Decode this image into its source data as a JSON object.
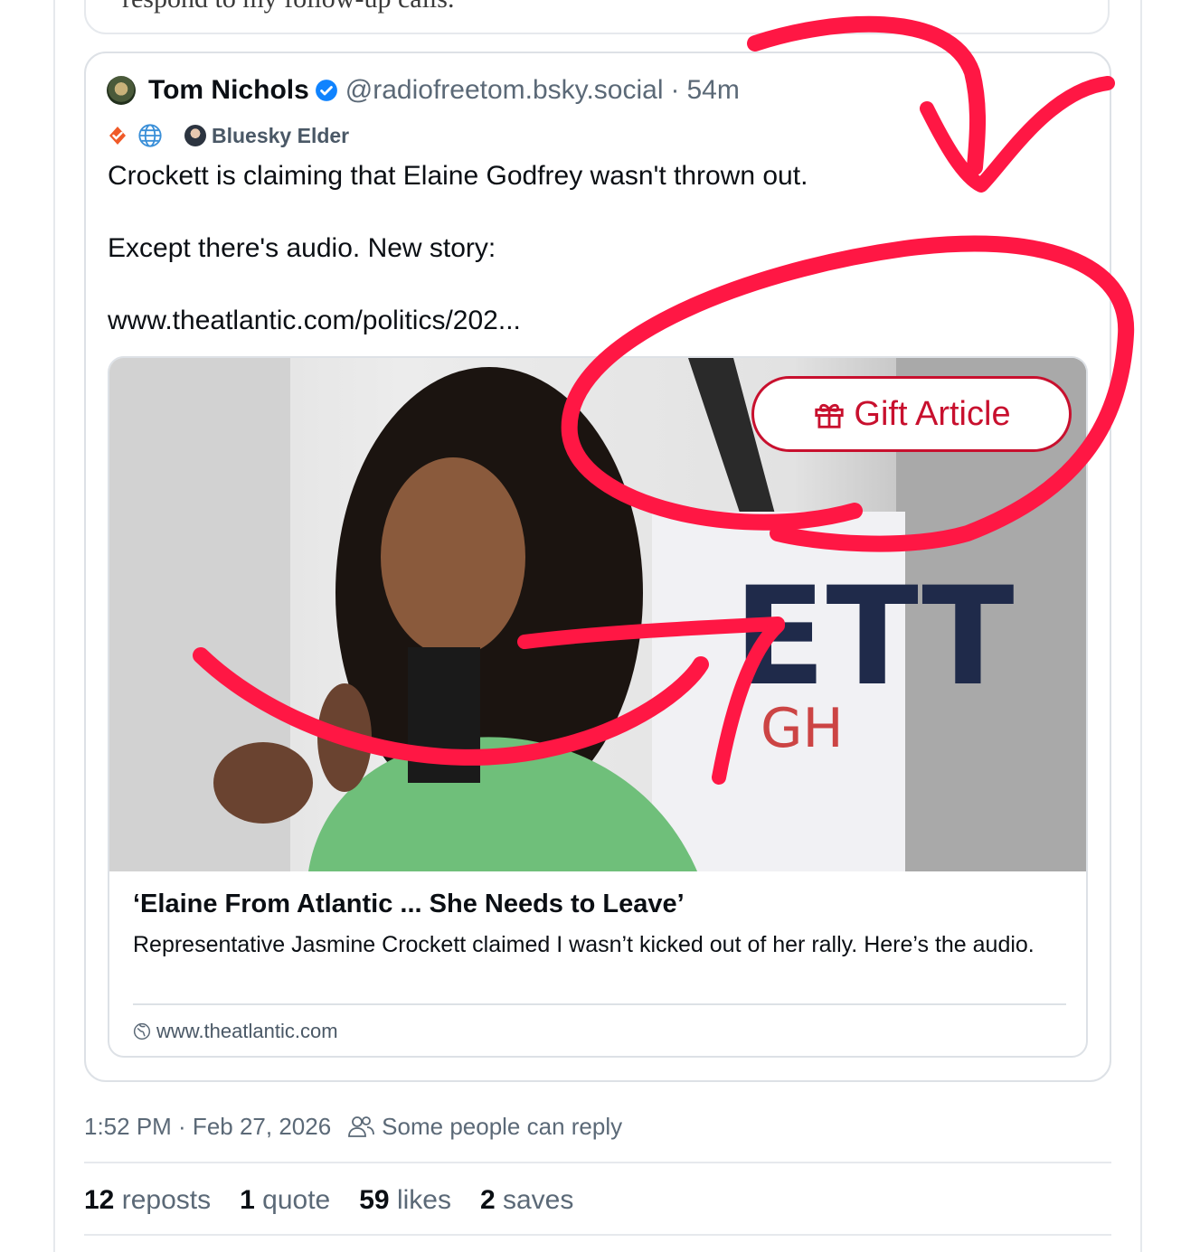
{
  "previous_post": {
    "text": "respond to my follow-up calls."
  },
  "quoted_post": {
    "author_name": "Tom Nichols",
    "handle": "@radiofreetom.bsky.social",
    "separator": "·",
    "time_ago": "54m",
    "badge_label": "Bluesky Elder",
    "text_lines": [
      "Crockett is claiming that Elaine Godfrey wasn't thrown out.",
      "Except there's audio. New story:",
      "www.theatlantic.com/politics/202..."
    ],
    "link_card": {
      "overlay_button": "Gift Article",
      "title": "‘Elaine From Atlantic ... She Needs to Leave’",
      "description": "Representative Jasmine Crockett claimed I wasn’t kicked out of her rally. Here’s the audio.",
      "domain": "www.theatlantic.com"
    }
  },
  "meta": {
    "timestamp": "1:52 PM · Feb 27, 2026",
    "reply_setting": "Some people can reply"
  },
  "stats": [
    {
      "count": "12",
      "label": "reposts"
    },
    {
      "count": "1",
      "label": "quote"
    },
    {
      "count": "59",
      "label": "likes"
    },
    {
      "count": "2",
      "label": "saves"
    }
  ],
  "colors": {
    "accent_blue": "#1083fe",
    "gift_red": "#c8102e",
    "annotation_red": "#ff1744",
    "muted_text": "#5b6977"
  }
}
